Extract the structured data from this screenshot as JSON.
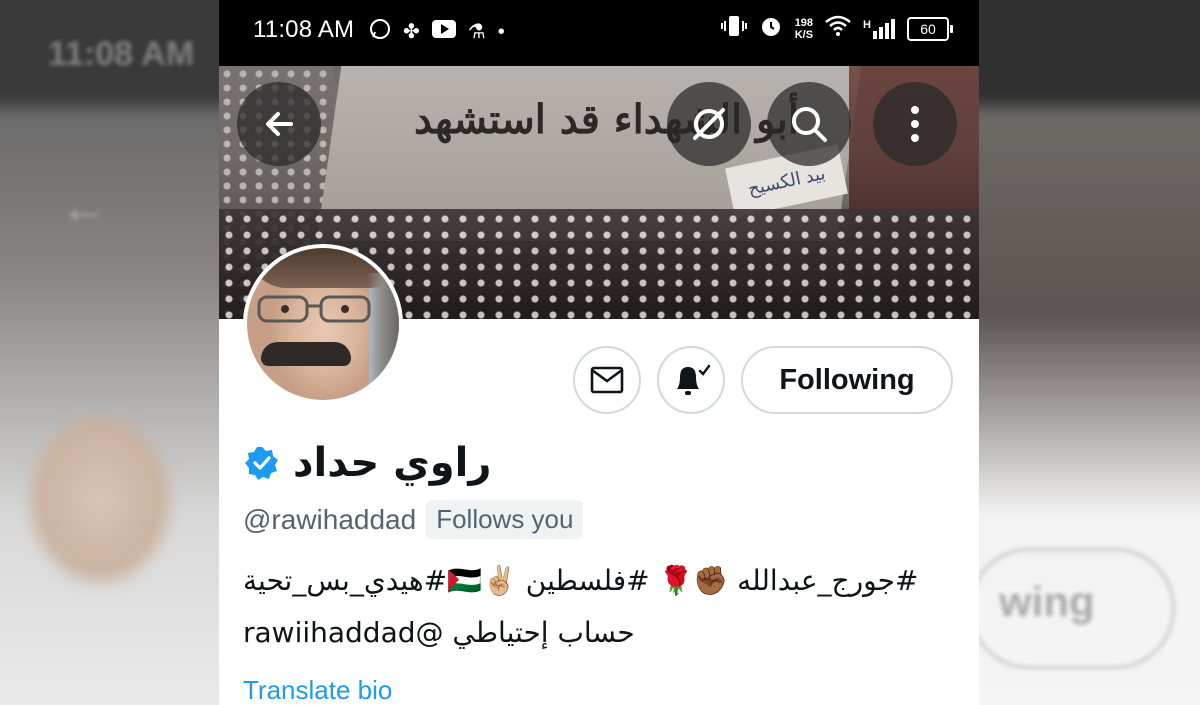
{
  "status_bar": {
    "time": "11:08 AM",
    "net_speed_value": "198",
    "net_speed_unit": "K/S",
    "battery": "60",
    "signal_label": "H"
  },
  "banner": {
    "wall_text": "أبو الشهداء قد استشهد",
    "flag_text": "بيد الكسيح"
  },
  "profile": {
    "display_name": "راوي حداد",
    "handle": "@rawihaddad",
    "follows_you": "Follows you",
    "verified": true,
    "bio_line_1": "#جورج_عبدالله ✊🏾🌹 #فلسطين ✌🏼🇵🇸#هيدي_بس_تحية",
    "bio_line_2": "حساب إحتياطي @rawiihaddad",
    "translate_bio": "Translate bio"
  },
  "actions": {
    "following_label": "Following"
  },
  "icons": {
    "back": "arrow-left-icon",
    "hide": "eye-slash-icon",
    "search": "search-icon",
    "more": "more-vertical-icon",
    "message": "mail-icon",
    "notifications": "bell-check-icon",
    "verified": "verified-badge-icon"
  },
  "colors": {
    "accent": "#1d9bf0",
    "text_primary": "#0f1419",
    "text_secondary": "#536471",
    "border": "#cfd9de"
  },
  "backdrop": {
    "ghost_time": "11:08 AM",
    "ghost_following": "wing"
  }
}
